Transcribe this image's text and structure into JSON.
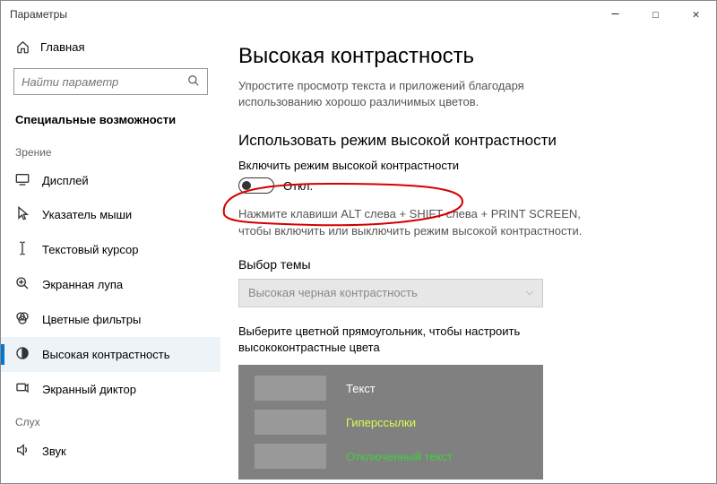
{
  "window": {
    "title": "Параметры"
  },
  "sidebar": {
    "home": "Главная",
    "search_placeholder": "Найти параметр",
    "category": "Специальные возможности",
    "group1_label": "Зрение",
    "group2_label": "Слух",
    "items": [
      {
        "icon": "display",
        "label": "Дисплей"
      },
      {
        "icon": "cursor",
        "label": "Указатель мыши"
      },
      {
        "icon": "text-cursor",
        "label": "Текстовый курсор"
      },
      {
        "icon": "magnifier",
        "label": "Экранная лупа"
      },
      {
        "icon": "filters",
        "label": "Цветные фильтры"
      },
      {
        "icon": "contrast",
        "label": "Высокая контрастность"
      },
      {
        "icon": "narrator",
        "label": "Экранный диктор"
      }
    ],
    "items2": [
      {
        "icon": "sound",
        "label": "Звук"
      }
    ]
  },
  "main": {
    "title": "Высокая контрастность",
    "description": "Упростите просмотр текста и приложений благодаря использованию хорошо различимых цветов.",
    "use_hc_heading": "Использовать режим высокой контрастности",
    "toggle_label": "Включить режим высокой контрастности",
    "toggle_state": "Откл.",
    "shortcut_hint": "Нажмите клавиши ALT слева + SHIFT слева + PRINT SCREEN, чтобы включить или выключить режим высокой контрастности.",
    "theme_label": "Выбор темы",
    "theme_value": "Высокая черная контрастность",
    "color_instr": "Выберите цветной прямоугольник, чтобы настроить высококонтрастные цвета",
    "swatches": {
      "text": "Текст",
      "link": "Гиперссылки",
      "disabled": "Отключенный текст"
    }
  }
}
